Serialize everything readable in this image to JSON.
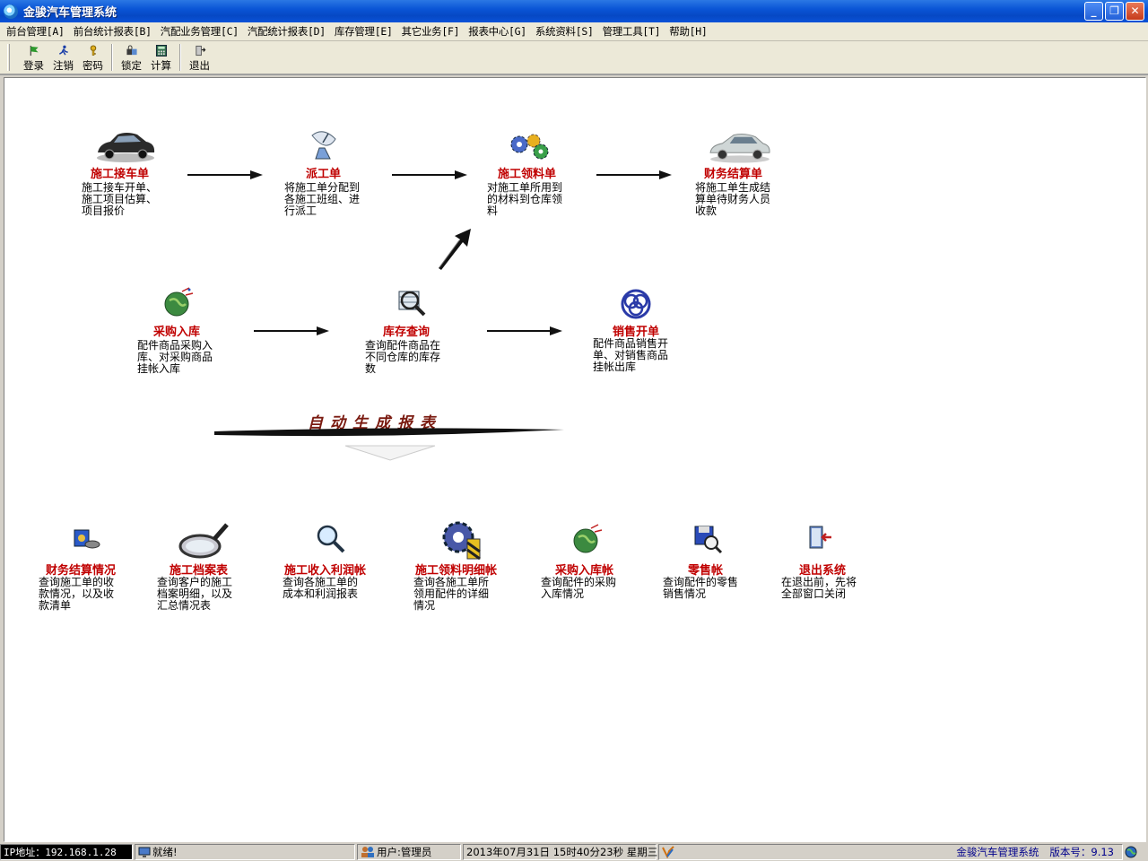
{
  "window": {
    "title": "金骏汽车管理系统"
  },
  "menu": [
    "前台管理[A]",
    "前台统计报表[B]",
    "汽配业务管理[C]",
    "汽配统计报表[D]",
    "库存管理[E]",
    "其它业务[F]",
    "报表中心[G]",
    "系统资料[S]",
    "管理工具[T]",
    "帮助[H]"
  ],
  "toolbar": {
    "login": "登录",
    "logout": "注销",
    "password": "密码",
    "lock": "锁定",
    "calc": "计算",
    "exit": "退出"
  },
  "flow": {
    "reception": {
      "title": "施工接车单",
      "desc": [
        "施工接车开单、",
        "施工项目估算、",
        "项目报价"
      ]
    },
    "dispatch": {
      "title": "派工单",
      "desc": [
        "将施工单分配到",
        "各施工班组、进",
        "行派工"
      ]
    },
    "material": {
      "title": "施工领料单",
      "desc": [
        "对施工单所用到",
        "的材料到仓库领",
        "料"
      ]
    },
    "settlement": {
      "title": "财务结算单",
      "desc": [
        "将施工单生成结",
        "算单待财务人员",
        "收款"
      ]
    },
    "purchase": {
      "title": "采购入库",
      "desc": [
        "配件商品采购入",
        "库、对采购商品",
        "挂帐入库"
      ]
    },
    "stock": {
      "title": "库存查询",
      "desc": [
        "查询配件商品在",
        "不同仓库的库存",
        "数"
      ]
    },
    "sales": {
      "title": "销售开单",
      "desc": [
        "配件商品销售开",
        "单、对销售商品",
        "挂帐出库"
      ]
    }
  },
  "banner": {
    "text": "自动生成报表"
  },
  "reports": {
    "finance": {
      "title": "财务结算情况",
      "desc": [
        "查询施工单的收",
        "款情况，以及收",
        "款清单"
      ]
    },
    "archive": {
      "title": "施工档案表",
      "desc": [
        "查询客户的施工",
        "档案明细，以及",
        "汇总情况表"
      ]
    },
    "profit": {
      "title": "施工收入利润帐",
      "desc": [
        "查询各施工单的",
        "成本和利润报表"
      ]
    },
    "material_detail": {
      "title": "施工领料明细帐",
      "desc": [
        "查询各施工单所",
        "领用配件的详细",
        "情况"
      ]
    },
    "purchase_ledger": {
      "title": "采购入库帐",
      "desc": [
        "查询配件的采购",
        "入库情况"
      ]
    },
    "retail": {
      "title": "零售帐",
      "desc": [
        "查询配件的零售",
        "销售情况"
      ]
    },
    "exit": {
      "title": "退出系统",
      "desc": [
        "在退出前，先将",
        "全部窗口关闭"
      ]
    }
  },
  "status": {
    "ip": "IP地址：192.168.1.28",
    "ready": "就绪!",
    "user": "用户:管理员",
    "datetime": "2013年07月31日 15时40分23秒  星期三",
    "app": "金骏汽车管理系统",
    "version": "版本号：9.13"
  },
  "colors": {
    "title_red": "#c00000",
    "titlebar_blue": "#0a55d6"
  }
}
